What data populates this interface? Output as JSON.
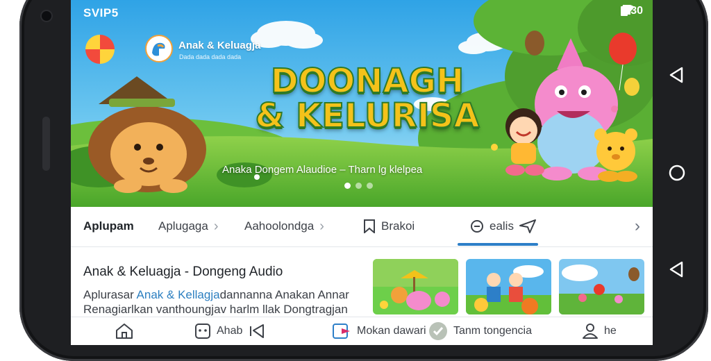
{
  "status_bar": {
    "carrier": "SVIP5",
    "time": "1:30"
  },
  "banner": {
    "app_name": "Anak & Keluagja",
    "app_subtitle": "Dada dada dada dada",
    "title_line1": "DOONAGH",
    "title_line2": "& KELURISA",
    "subtitle": "Anaka Dongem Alaudioe  – Tharn lg klelpea",
    "page_count": 3,
    "active_page": 0
  },
  "tabs": {
    "items": [
      {
        "label": "Aplupam"
      },
      {
        "label": "Aplugaga"
      },
      {
        "label": "Aahoolondga"
      },
      {
        "label": "Brakoi"
      },
      {
        "label": "ealis"
      }
    ]
  },
  "content": {
    "title": "Anak & Keluagja - Dongeng Audio",
    "desc_part1": "Aplurasar ",
    "desc_link": "Anak & Kellagja",
    "desc_part2": "dannanna Anakan Annar",
    "desc_line2": "Renagiarlkan vanthoungjav harlm llak Dongtragjan"
  },
  "bottom_nav": {
    "items": [
      {
        "label": "",
        "icon": "home-icon"
      },
      {
        "label": "Ahab",
        "icon": "robot-icon"
      },
      {
        "label": "Mokan dawari",
        "icon": "bookmark-icon"
      },
      {
        "label": "Tanm tongencia",
        "icon": "check-circle-icon"
      },
      {
        "label": "he",
        "icon": "user-icon"
      }
    ]
  },
  "colors": {
    "accent": "#2d7fc8",
    "title_fill": "#f4c21a",
    "title_stroke": "#2f7a26",
    "phone_body": "#1e1f22"
  }
}
